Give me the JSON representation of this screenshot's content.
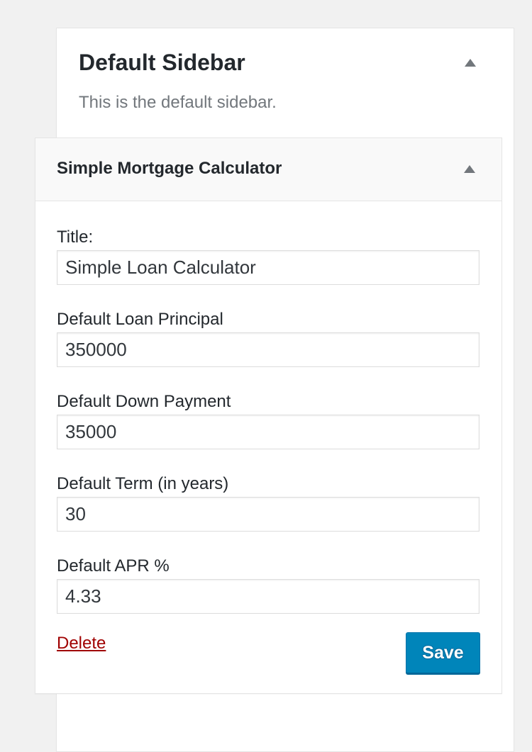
{
  "sidebar": {
    "title": "Default Sidebar",
    "description": "This is the default sidebar."
  },
  "widget": {
    "title": "Simple Mortgage Calculator",
    "fields": {
      "title": {
        "label": "Title:",
        "value": "Simple Loan Calculator"
      },
      "principal": {
        "label": "Default Loan Principal",
        "value": "350000"
      },
      "down_payment": {
        "label": "Default Down Payment",
        "value": "35000"
      },
      "term": {
        "label": "Default Term (in years)",
        "value": "30"
      },
      "apr": {
        "label": "Default APR %",
        "value": "4.33"
      }
    },
    "delete_label": "Delete",
    "save_label": "Save"
  },
  "icons": {
    "toggle": "triangle-up-icon"
  },
  "colors": {
    "background": "#f1f1f1",
    "primary_button": "#0085ba",
    "delete_link": "#a00000"
  }
}
